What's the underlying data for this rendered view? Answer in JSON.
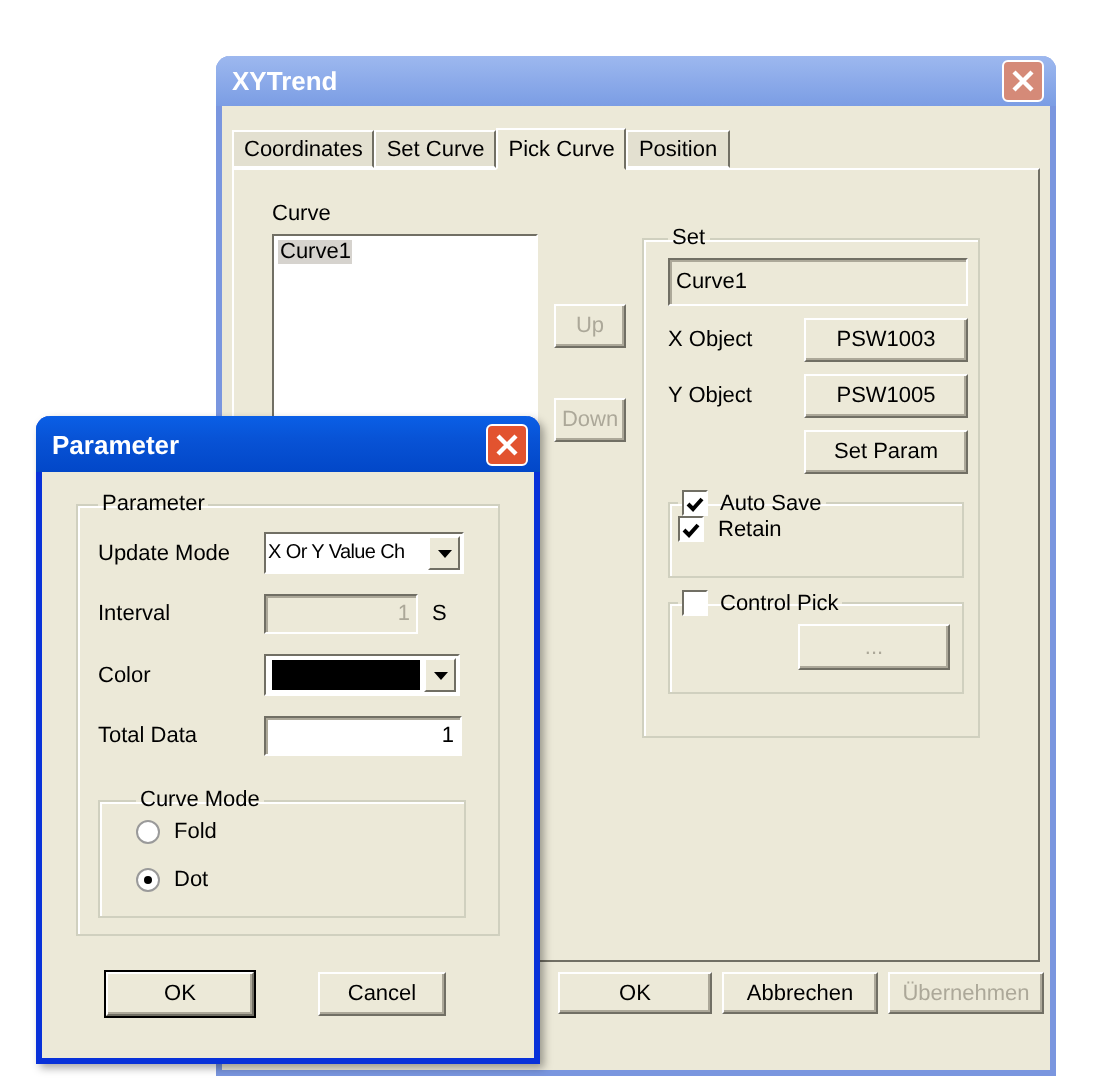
{
  "main_window": {
    "title": "XYTrend",
    "tabs": [
      {
        "label": "Coordinates",
        "selected": false
      },
      {
        "label": "Set Curve",
        "selected": false
      },
      {
        "label": "Pick Curve",
        "selected": true
      },
      {
        "label": "Position",
        "selected": false
      }
    ],
    "curve_list": {
      "label": "Curve",
      "items": [
        {
          "text": "Curve1",
          "selected": true
        }
      ]
    },
    "side_buttons": [
      {
        "label": "Up",
        "disabled": true
      },
      {
        "label": "Down",
        "disabled": true
      }
    ],
    "set_group": {
      "title": "Set",
      "name_field": {
        "value": "Curve1",
        "disabled": true
      },
      "objects": [
        {
          "label": "X Object",
          "value": "PSW1003"
        },
        {
          "label": "Y Object",
          "value": "PSW1005"
        }
      ],
      "set_param": "Set Param",
      "auto_save": {
        "label": "Auto Save",
        "checked": true
      },
      "retain": {
        "label": "Retain",
        "checked": true
      },
      "control_pick": {
        "label": "Control Pick",
        "checked": false
      },
      "pick_button": {
        "label": "...",
        "disabled": true
      }
    },
    "buttons": [
      {
        "label": "OK",
        "disabled": false
      },
      {
        "label": "Abbrechen",
        "disabled": false
      },
      {
        "label": "Übernehmen",
        "disabled": true
      }
    ]
  },
  "parameter_dialog": {
    "title": "Parameter",
    "group_title": "Parameter",
    "update_mode": {
      "label": "Update Mode",
      "value": "X Or Y Value Ch"
    },
    "interval": {
      "label": "Interval",
      "value": "1",
      "unit": "S",
      "disabled": true
    },
    "color": {
      "label": "Color",
      "color": "#000000"
    },
    "total_data": {
      "label": "Total Data",
      "value": "1"
    },
    "curve_mode": {
      "title": "Curve Mode",
      "options": [
        {
          "label": "Fold",
          "selected": false
        },
        {
          "label": "Dot",
          "selected": true
        }
      ]
    },
    "buttons": [
      {
        "label": "OK",
        "default": true
      },
      {
        "label": "Cancel",
        "default": false
      }
    ]
  }
}
